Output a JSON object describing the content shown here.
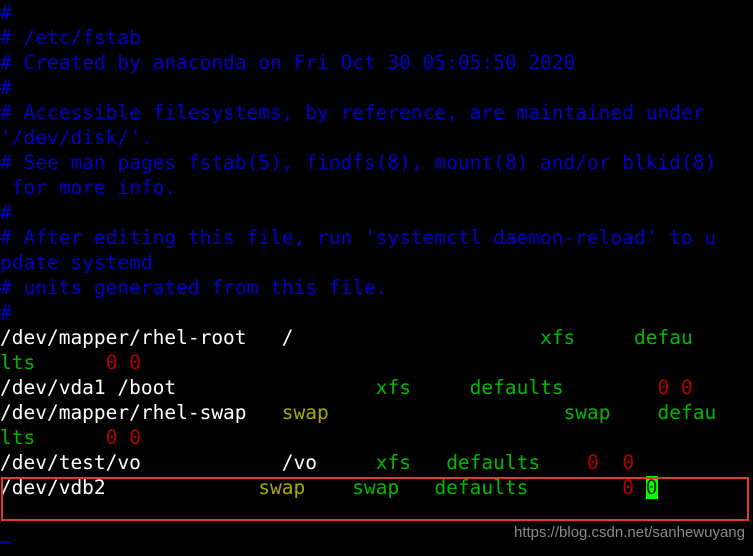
{
  "terminal": {
    "app": "vim",
    "file": "/etc/fstab",
    "background_color": "#000000",
    "columns": 53,
    "rows": 22
  },
  "colors": {
    "comment": "#0000c8",
    "device": "#ffffff",
    "fstype_options": "#00b800",
    "swap_mountpoint": "#a8a800",
    "dump_pass": "#b00000",
    "cursor_background": "#00ff00",
    "annotation_box": "#e03a30",
    "watermark": "#8a8a8a"
  },
  "comments": [
    "#",
    "# /etc/fstab",
    "# Created by anaconda on Fri Oct 30 05:05:50 2020",
    "#",
    "# Accessible filesystems, by reference, are maintained under",
    "'/dev/disk/'.",
    "# See man pages fstab(5), findfs(8), mount(8) and/or blkid(8)",
    " for more info.",
    "#",
    "# After editing this file, run 'systemctl daemon-reload' to u",
    "pdate systemd",
    "# units generated from this file.",
    "#"
  ],
  "comment_wrapped_lines": [
    {
      "text": "#"
    },
    {
      "text": "# /etc/fstab"
    },
    {
      "text": "# Created by anaconda on Fri Oct 30 05:05:50 2020"
    },
    {
      "text": "#"
    },
    {
      "text": "# Accessible filesystems, by reference, are maintained under"
    },
    {
      "text": "'/dev/disk/'."
    },
    {
      "text": "# See man pages fstab(5), findfs(8), mount(8) and/or blkid(8)"
    },
    {
      "text": " for more info."
    },
    {
      "text": "#"
    },
    {
      "text": "# After editing this file, run 'systemctl daemon-reload' to u"
    },
    {
      "text": "pdate systemd"
    },
    {
      "text": "# units generated from this file."
    },
    {
      "text": "#"
    }
  ],
  "fstab_entries": [
    {
      "device": "/dev/mapper/rhel-root",
      "mountpoint": "/",
      "fstype": "xfs",
      "options": "defaults",
      "dump": "0",
      "pass": "0",
      "mountpoint_is_swap": false
    },
    {
      "device": "/dev/vda1",
      "mountpoint": "/boot",
      "fstype": "xfs",
      "options": "defaults",
      "dump": "0",
      "pass": "0",
      "mountpoint_is_swap": false
    },
    {
      "device": "/dev/mapper/rhel-swap",
      "mountpoint": "swap",
      "fstype": "swap",
      "options": "defaults",
      "dump": "0",
      "pass": "0",
      "mountpoint_is_swap": true
    },
    {
      "device": "/dev/test/vo",
      "mountpoint": "/vo",
      "fstype": "xfs",
      "options": "defaults",
      "dump": "0",
      "pass": "0",
      "mountpoint_is_swap": false
    },
    {
      "device": "/dev/vdb2",
      "mountpoint": "swap",
      "fstype": "swap",
      "options": "defaults",
      "dump": "0",
      "pass": "0",
      "mountpoint_is_swap": true,
      "highlighted": true,
      "cursor_on": "pass"
    }
  ],
  "rendered_entry_lines": [
    {
      "seg": [
        {
          "t": "/dev/mapper/rhel-root",
          "c": "device"
        },
        {
          "t": "   ",
          "c": "plain"
        },
        {
          "t": "/",
          "c": "device"
        },
        {
          "t": "                     ",
          "c": "plain"
        },
        {
          "t": "xfs",
          "c": "green"
        },
        {
          "t": "     ",
          "c": "plain"
        },
        {
          "t": "defau",
          "c": "green"
        }
      ]
    },
    {
      "seg": [
        {
          "t": "lts",
          "c": "green"
        },
        {
          "t": "      ",
          "c": "plain"
        },
        {
          "t": "0",
          "c": "red"
        },
        {
          "t": " ",
          "c": "plain"
        },
        {
          "t": "0",
          "c": "red"
        }
      ]
    },
    {
      "seg": [
        {
          "t": "/dev/vda1",
          "c": "device"
        },
        {
          "t": " ",
          "c": "plain"
        },
        {
          "t": "/boot",
          "c": "device"
        },
        {
          "t": "                 ",
          "c": "plain"
        },
        {
          "t": "xfs",
          "c": "green"
        },
        {
          "t": "     ",
          "c": "plain"
        },
        {
          "t": "defaults",
          "c": "green"
        },
        {
          "t": "        ",
          "c": "plain"
        },
        {
          "t": "0",
          "c": "red"
        },
        {
          "t": " ",
          "c": "plain"
        },
        {
          "t": "0",
          "c": "red"
        }
      ]
    },
    {
      "seg": [
        {
          "t": "/dev/mapper/rhel-swap",
          "c": "device"
        },
        {
          "t": "   ",
          "c": "plain"
        },
        {
          "t": "swap",
          "c": "yellow"
        },
        {
          "t": "                    ",
          "c": "plain"
        },
        {
          "t": "swap",
          "c": "green"
        },
        {
          "t": "    ",
          "c": "plain"
        },
        {
          "t": "defau",
          "c": "green"
        }
      ]
    },
    {
      "seg": [
        {
          "t": "lts",
          "c": "green"
        },
        {
          "t": "      ",
          "c": "plain"
        },
        {
          "t": "0",
          "c": "red"
        },
        {
          "t": " ",
          "c": "plain"
        },
        {
          "t": "0",
          "c": "red"
        }
      ]
    },
    {
      "seg": [
        {
          "t": "/dev/test/vo",
          "c": "device"
        },
        {
          "t": "            ",
          "c": "plain"
        },
        {
          "t": "/vo",
          "c": "device"
        },
        {
          "t": "     ",
          "c": "plain"
        },
        {
          "t": "xfs",
          "c": "green"
        },
        {
          "t": "   ",
          "c": "plain"
        },
        {
          "t": "defaults",
          "c": "green"
        },
        {
          "t": "    ",
          "c": "plain"
        },
        {
          "t": "0",
          "c": "red"
        },
        {
          "t": "  ",
          "c": "plain"
        },
        {
          "t": "0",
          "c": "red"
        }
      ]
    },
    {
      "seg": [
        {
          "t": "/dev/vdb2",
          "c": "device"
        },
        {
          "t": "             ",
          "c": "plain"
        },
        {
          "t": "swap",
          "c": "yellow"
        },
        {
          "t": "    ",
          "c": "plain"
        },
        {
          "t": "swap",
          "c": "green"
        },
        {
          "t": "   ",
          "c": "plain"
        },
        {
          "t": "defaults",
          "c": "green"
        },
        {
          "t": "        ",
          "c": "plain"
        },
        {
          "t": "0",
          "c": "red"
        },
        {
          "t": " ",
          "c": "plain"
        },
        {
          "t": "0",
          "c": "cursor"
        }
      ]
    }
  ],
  "filler": {
    "tilde": "~"
  },
  "watermark": {
    "text": "https://blog.csdn.net/sanhewuyang"
  }
}
